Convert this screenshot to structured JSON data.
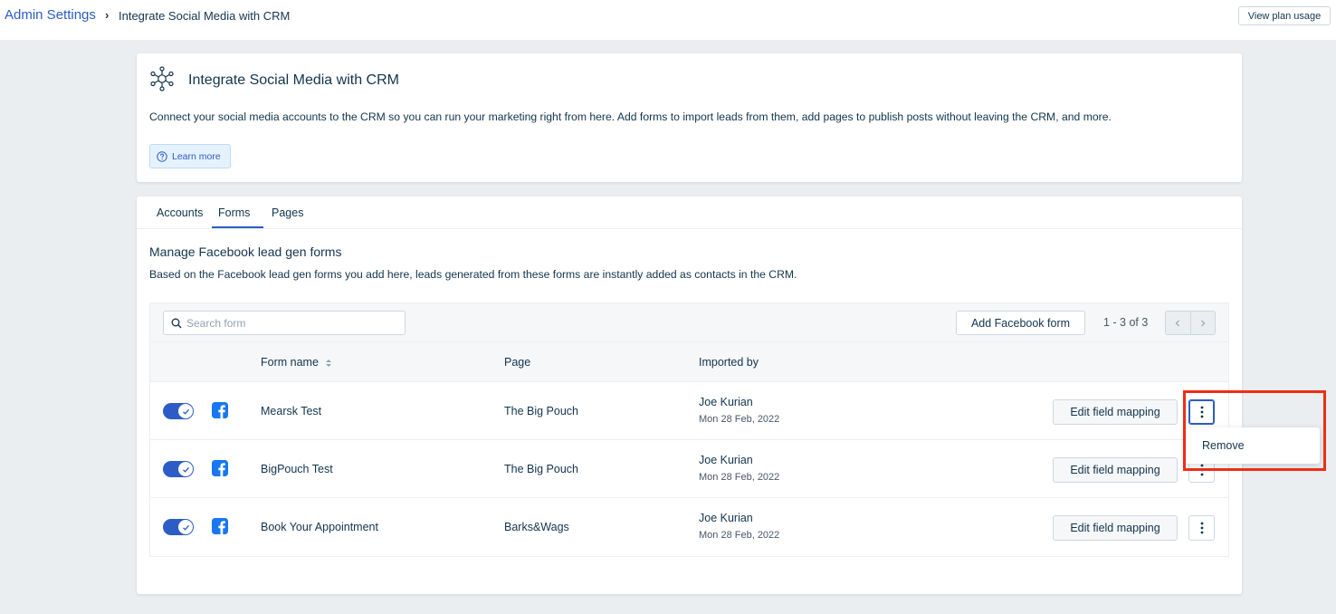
{
  "breadcrumb": {
    "root": "Admin Settings",
    "separator": "›",
    "current": "Integrate Social Media with CRM"
  },
  "header": {
    "plan_button": "View plan usage"
  },
  "intro": {
    "title": "Integrate Social Media with CRM",
    "description": "Connect your social media accounts to the CRM so you can run your marketing right from here. Add forms to import leads from them, add pages to publish posts without leaving the CRM, and more.",
    "learn_more": "Learn more"
  },
  "tabs": [
    {
      "label": "Accounts",
      "active": false
    },
    {
      "label": "Forms",
      "active": true
    },
    {
      "label": "Pages",
      "active": false
    }
  ],
  "section": {
    "title": "Manage Facebook lead gen forms",
    "description": "Based on the Facebook lead gen forms you add here, leads generated from these forms are instantly added as contacts in the CRM."
  },
  "toolbar": {
    "search_placeholder": "Search form",
    "add_button": "Add Facebook form",
    "pager_text": "1 - 3 of 3"
  },
  "columns": {
    "form_name": "Form name",
    "page": "Page",
    "imported_by": "Imported by"
  },
  "rows": [
    {
      "name": "Mearsk Test",
      "page": "The Big Pouch",
      "imported_by": "Joe Kurian",
      "date": "Mon 28 Feb, 2022",
      "enabled": true,
      "edit": "Edit field mapping"
    },
    {
      "name": "BigPouch Test",
      "page": "The Big Pouch",
      "imported_by": "Joe Kurian",
      "date": "Mon 28 Feb, 2022",
      "enabled": true,
      "edit": "Edit field mapping"
    },
    {
      "name": "Book Your Appointment",
      "page": "Barks&Wags",
      "imported_by": "Joe Kurian",
      "date": "Mon 28 Feb, 2022",
      "enabled": true,
      "edit": "Edit field mapping"
    }
  ],
  "row_menu": {
    "remove": "Remove"
  },
  "colors": {
    "primary": "#2c5cc5",
    "text": "#12344d",
    "highlight": "#ee2d14",
    "facebook": "#1877f2"
  }
}
